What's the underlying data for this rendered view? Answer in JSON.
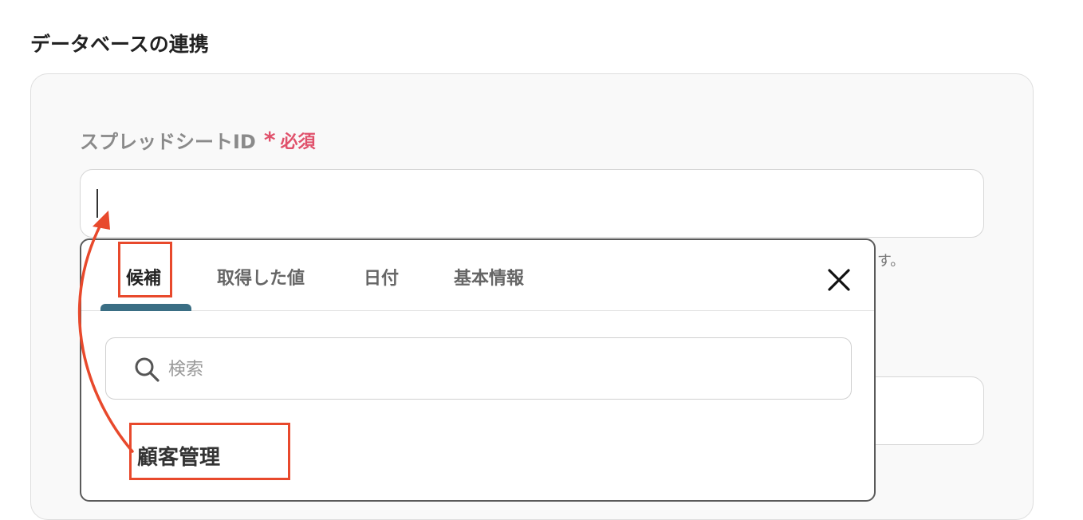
{
  "section": {
    "title": "データベースの連携"
  },
  "field": {
    "label": "スプレッドシートID",
    "required_mark": "*",
    "required_text": "必須",
    "value": "",
    "help_tail": "す。"
  },
  "popup": {
    "tabs": [
      {
        "label": "候補",
        "active": true
      },
      {
        "label": "取得した値",
        "active": false
      },
      {
        "label": "日付",
        "active": false
      },
      {
        "label": "基本情報",
        "active": false
      }
    ],
    "search_placeholder": "検索",
    "candidates": [
      {
        "label": "顧客管理"
      }
    ]
  },
  "colors": {
    "required": "#e0516b",
    "tab_indicator": "#3a6e84",
    "annotation": "#e8492c"
  }
}
